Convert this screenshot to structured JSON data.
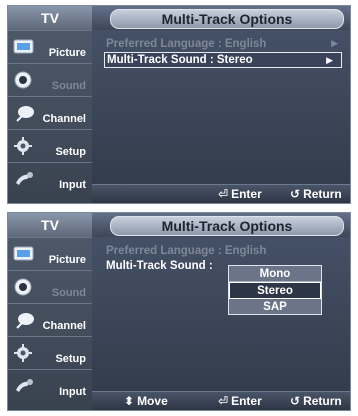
{
  "sidebar": {
    "title": "TV",
    "items": [
      {
        "label": "Picture",
        "icon": "picture-icon"
      },
      {
        "label": "Sound",
        "icon": "sound-icon"
      },
      {
        "label": "Channel",
        "icon": "channel-icon"
      },
      {
        "label": "Setup",
        "icon": "setup-icon"
      },
      {
        "label": "Input",
        "icon": "input-icon"
      }
    ]
  },
  "screen1": {
    "title": "Multi-Track Options",
    "rows": [
      {
        "text": "Preferred Language : English",
        "arrow": "▶"
      },
      {
        "text": "Multi-Track Sound : Stereo",
        "arrow": "▶"
      }
    ],
    "footer": {
      "enter": "Enter",
      "return": "Return"
    }
  },
  "screen2": {
    "title": "Multi-Track Options",
    "rows": [
      {
        "text": "Preferred Language : English"
      },
      {
        "text": "Multi-Track Sound :"
      }
    ],
    "options": [
      "Mono",
      "Stereo",
      "SAP"
    ],
    "selected_option": "Stereo",
    "footer": {
      "move": "Move",
      "enter": "Enter",
      "return": "Return"
    }
  },
  "colors": {
    "panel_bg": "#39424f",
    "accent_text": "#ffffff",
    "dim_text": "#7d889a"
  }
}
